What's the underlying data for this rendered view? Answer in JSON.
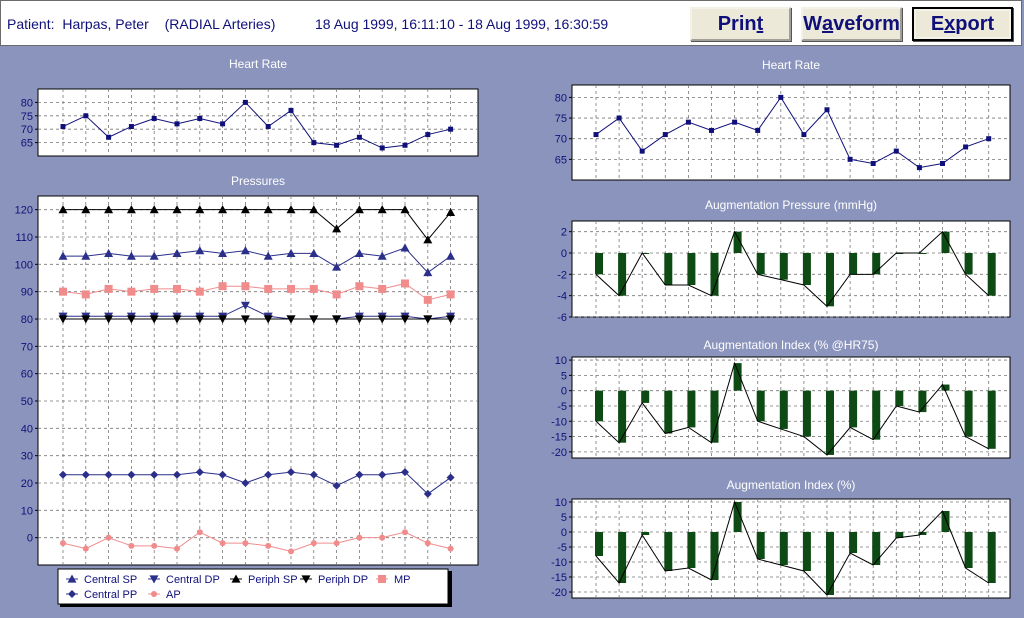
{
  "header": {
    "patient_label": "Patient:",
    "patient_name": "Harpas, Peter",
    "artery": "(RADIAL Arteries)",
    "date_range": "18 Aug 1999, 16:11:10 - 18 Aug 1999, 16:30:59",
    "buttons": {
      "print": {
        "pre": "Prin",
        "mn": "t",
        "post": ""
      },
      "waveform": {
        "pre": "W",
        "mn": "a",
        "post": "veform"
      },
      "export": {
        "pre": "E",
        "mn": "x",
        "post": "port"
      }
    }
  },
  "colors": {
    "background": "#8b94bc",
    "line": "#10107a",
    "bar": "#0d4a14",
    "mp": "#f08c8c",
    "grid": "#777777"
  },
  "chart_data": [
    {
      "id": "hr_left",
      "type": "line",
      "title": "Heart Rate",
      "ylim": [
        60,
        85
      ],
      "yticks": [
        65,
        70,
        75,
        80
      ],
      "grid": true,
      "series": [
        {
          "values": [
            71,
            75,
            67,
            71,
            74,
            72,
            74,
            72,
            80,
            71,
            77,
            65,
            64,
            67,
            63,
            64,
            68,
            70
          ]
        }
      ]
    },
    {
      "id": "pressures",
      "type": "line",
      "title": "Pressures",
      "ylim": [
        -10,
        125
      ],
      "yticks": [
        0,
        10,
        20,
        30,
        40,
        50,
        60,
        70,
        80,
        90,
        100,
        110,
        120
      ],
      "grid": true,
      "legend": "bottom",
      "series": [
        {
          "name": "Central SP",
          "marker": "tri-up",
          "values": [
            103,
            103,
            104,
            103,
            103,
            104,
            105,
            104,
            105,
            103,
            104,
            104,
            99,
            104,
            103,
            106,
            97,
            103
          ]
        },
        {
          "name": "Central DP",
          "marker": "tri-down",
          "values": [
            81,
            81,
            81,
            81,
            81,
            81,
            81,
            81,
            85,
            81,
            80,
            80,
            80,
            81,
            81,
            81,
            80,
            81
          ]
        },
        {
          "name": "Periph SP",
          "marker": "tri-up",
          "values": [
            120,
            120,
            120,
            120,
            120,
            120,
            120,
            120,
            120,
            120,
            120,
            120,
            113,
            120,
            120,
            120,
            109,
            119
          ]
        },
        {
          "name": "Periph DP",
          "marker": "tri-down",
          "values": [
            80,
            80,
            80,
            80,
            80,
            80,
            80,
            80,
            80,
            80,
            80,
            80,
            80,
            80,
            80,
            80,
            80,
            80
          ]
        },
        {
          "name": "MP",
          "marker": "square",
          "values": [
            90,
            89,
            91,
            90,
            91,
            91,
            90,
            92,
            92,
            91,
            91,
            91,
            89,
            92,
            91,
            93,
            87,
            89
          ]
        },
        {
          "name": "Central PP",
          "marker": "diamond",
          "values": [
            23,
            23,
            23,
            23,
            23,
            23,
            24,
            23,
            20,
            23,
            24,
            23,
            19,
            23,
            23,
            24,
            16,
            22
          ]
        },
        {
          "name": "AP",
          "marker": "circle",
          "values": [
            -2,
            -4,
            0,
            -3,
            -3,
            -4,
            2,
            -2,
            -2,
            -3,
            -5,
            -2,
            -2,
            0,
            0,
            2,
            -2,
            -4
          ]
        }
      ]
    },
    {
      "id": "hr_right",
      "type": "line",
      "title": "Heart Rate",
      "ylim": [
        60,
        83
      ],
      "yticks": [
        65,
        70,
        75,
        80
      ],
      "grid": true,
      "series": [
        {
          "values": [
            71,
            75,
            67,
            71,
            74,
            72,
            74,
            72,
            80,
            71,
            77,
            65,
            64,
            67,
            63,
            64,
            68,
            70
          ]
        }
      ]
    },
    {
      "id": "aug_pressure",
      "type": "bar",
      "title": "Augmentation Pressure (mmHg)",
      "ylim": [
        -6,
        3
      ],
      "yticks": [
        2,
        0,
        -2,
        -4,
        -6
      ],
      "grid": true,
      "series": [
        {
          "values": [
            -2,
            -4,
            0,
            -3,
            -3,
            -4,
            2,
            -2,
            -2.5,
            -3,
            -5,
            -2,
            -2,
            0,
            0,
            2,
            -2,
            -4
          ]
        }
      ]
    },
    {
      "id": "aug_index_hr75",
      "type": "bar",
      "title": "Augmentation Index (% @HR75)",
      "ylim": [
        -22,
        11
      ],
      "yticks": [
        10,
        5,
        0,
        -5,
        -10,
        -15,
        -20
      ],
      "grid": true,
      "series": [
        {
          "values": [
            -10,
            -17,
            -4,
            -14,
            -12,
            -17,
            9,
            -10,
            -12.5,
            -15,
            -21,
            -12,
            -16,
            -5,
            -7,
            2,
            -15,
            -19
          ]
        }
      ]
    },
    {
      "id": "aug_index",
      "type": "bar",
      "title": "Augmentation Index (%)",
      "ylim": [
        -22,
        11
      ],
      "yticks": [
        10,
        5,
        0,
        -5,
        -10,
        -15,
        -20
      ],
      "grid": true,
      "series": [
        {
          "values": [
            -8,
            -17,
            -1,
            -13,
            -12,
            -16,
            10,
            -9,
            -11,
            -13,
            -21,
            -7,
            -11,
            -2,
            -1,
            7,
            -12,
            -17
          ]
        }
      ]
    }
  ]
}
